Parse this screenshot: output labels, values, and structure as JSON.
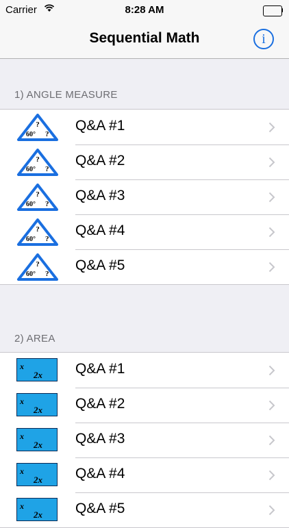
{
  "status_bar": {
    "carrier": "Carrier",
    "time": "8:28 AM"
  },
  "nav": {
    "title": "Sequential Math",
    "info_label": "i"
  },
  "sections": [
    {
      "header": "1) ANGLE MEASURE",
      "thumb": {
        "angle": "60°",
        "unknown": "?"
      },
      "items": [
        {
          "label": "Q&A  #1"
        },
        {
          "label": "Q&A  #2"
        },
        {
          "label": "Q&A  #3"
        },
        {
          "label": "Q&A  #4"
        },
        {
          "label": "Q&A  #5"
        }
      ]
    },
    {
      "header": "2) AREA",
      "thumb": {
        "width": "x",
        "length": "2x"
      },
      "items": [
        {
          "label": "Q&A  #1"
        },
        {
          "label": "Q&A  #2"
        },
        {
          "label": "Q&A  #3"
        },
        {
          "label": "Q&A  #4"
        },
        {
          "label": "Q&A  #5"
        }
      ]
    }
  ],
  "colors": {
    "accent": "#1a6fe0",
    "triangle": "#1a6fe0",
    "area_fill": "#1fa3e6"
  }
}
